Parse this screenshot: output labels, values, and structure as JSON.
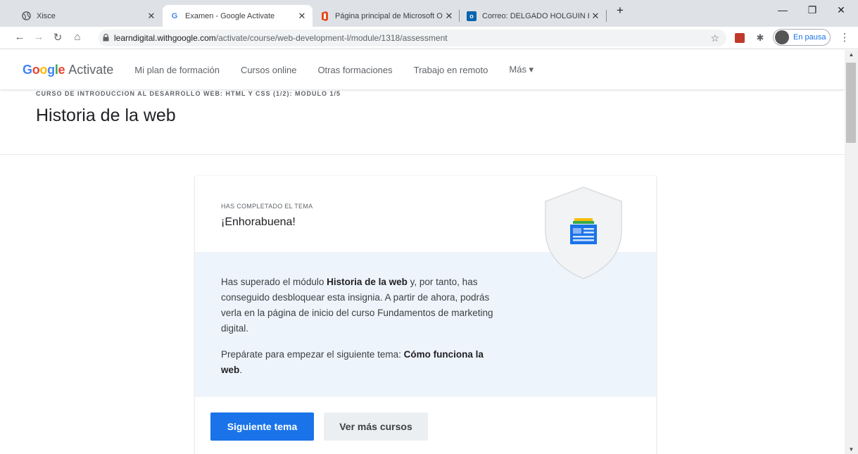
{
  "browser": {
    "tabs": [
      {
        "title": "Xisce",
        "favicon": "globe-icon"
      },
      {
        "title": "Examen - Google Activate",
        "favicon": "google-g-icon"
      },
      {
        "title": "Página principal de Microsoft Off",
        "favicon": "office-icon"
      },
      {
        "title": "Correo: DELGADO HOLGUIN KEV",
        "favicon": "outlook-icon"
      }
    ],
    "new_tab": "+",
    "url_host": "learndigital.withgoogle.com",
    "url_path": "/activate/course/web-development-l/module/1318/assessment",
    "profile_status": "En pausa"
  },
  "site": {
    "logo_google": "Google",
    "logo_activate": "Activate",
    "nav": [
      "Mi plan de formación",
      "Cursos online",
      "Otras formaciones",
      "Trabajo en remoto",
      "Más ▾"
    ]
  },
  "module": {
    "course_line": "CURSO DE INTRODUCCION AL DESARROLLO WEB: HTML Y CSS (1/2): MODULO 1/5",
    "title": "Historia de la web"
  },
  "card": {
    "kicker": "HAS COMPLETADO EL TEMA",
    "heading": "¡Enhorabuena!",
    "p1_a": "Has superado el módulo ",
    "p1_bold": "Historia de la web",
    "p1_b": " y, por tanto, has conseguido desbloquear esta insignia. A partir de ahora, podrás verla en la página de inicio del curso Fundamentos de marketing digital.",
    "p2_a": "Prepárate para empezar el siguiente tema: ",
    "p2_bold": "Cómo funciona la web",
    "p2_b": ".",
    "primary_button": "Siguiente tema",
    "secondary_button": "Ver más cursos"
  },
  "colors": {
    "accent": "#1a73e8",
    "card_band": "#eef4fb",
    "tabbar": "#dee1e6"
  }
}
